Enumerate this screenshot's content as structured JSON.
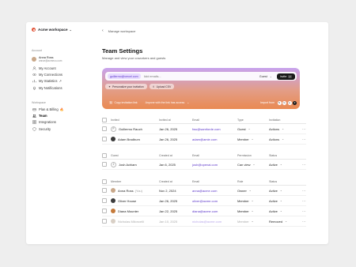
{
  "workspace": {
    "name": "Acme workspace"
  },
  "sidebar": {
    "account_label": "Account",
    "user": {
      "name": "Anna Ross",
      "email": "annar@acmeco.com"
    },
    "account_items": [
      {
        "label": "My Account",
        "icon": "user-icon"
      },
      {
        "label": "My Connections",
        "icon": "link-icon"
      },
      {
        "label": "My Statistics",
        "icon": "chart-icon",
        "suffix": "↗"
      },
      {
        "label": "My Notifications",
        "icon": "bell-icon"
      }
    ],
    "workspace_label": "Workspace",
    "workspace_items": [
      {
        "label": "Plan & Billing",
        "icon": "card-icon",
        "badge": "🔥"
      },
      {
        "label": "Team",
        "icon": "team-icon",
        "active": true
      },
      {
        "label": "Integrations",
        "icon": "grid-icon"
      },
      {
        "label": "Security",
        "icon": "shield-icon"
      }
    ]
  },
  "breadcrumb": {
    "label": "Manage workspace"
  },
  "page": {
    "title": "Team Settings",
    "subtitle": "Manage and view your coworkers and guests"
  },
  "invite": {
    "email_chip": "guillermo@vercel.com",
    "placeholder": "Add emails...",
    "role": "Guest",
    "button_label": "Invite",
    "button_kbd": "↵",
    "pills": [
      {
        "icon": "sparkle-icon",
        "label": "Personalize your invitation"
      },
      {
        "icon": "upload-icon",
        "label": "Upload CSV"
      }
    ],
    "copy_link_label": "Copy invitation link",
    "link_access_label": "Anyone with the link has access",
    "import_label": "Import from"
  },
  "invited_table": {
    "headers": [
      "Invited",
      "Invited at",
      "Email",
      "Type",
      "Invitation"
    ],
    "rows": [
      {
        "name": "Guillermo Rauch",
        "date": "Jan 26, 2025",
        "email": "fwu@samforde.com",
        "role": "Guest",
        "status": "Actions",
        "avatar_letter": "F",
        "avatar_color": "#ffffff"
      },
      {
        "name": "Adam Bradburn",
        "date": "Jan 26, 2025",
        "email": "adam@amie.com",
        "role": "Member",
        "status": "Actions",
        "avatar_letter": "",
        "avatar_color": "#3a3a3a"
      }
    ]
  },
  "guest_table": {
    "headers": [
      "Guest",
      "Created at",
      "Email",
      "Permission",
      "Status"
    ],
    "rows": [
      {
        "name": "Josh Achiam",
        "date": "Jan 6, 2025",
        "email": "josh@openai.com",
        "role": "Can view",
        "status": "Active",
        "avatar_letter": "J",
        "avatar_color": "#ffffff"
      }
    ]
  },
  "member_table": {
    "headers": [
      "Member",
      "Created at",
      "Email",
      "Role",
      "Status"
    ],
    "rows": [
      {
        "name": "Anna Ross",
        "you": "(You)",
        "date": "Nov 2, 2024",
        "email": "anna@acme.com",
        "role": "Owner",
        "status": "Active",
        "avatar_color": "#c9a88a"
      },
      {
        "name": "Oliver House",
        "date": "Jan 26, 2025",
        "email": "oliver@acme.com",
        "role": "Member",
        "status": "Active",
        "avatar_color": "#3c3c3c"
      },
      {
        "name": "Diana Mounter",
        "date": "Jan 22, 2025",
        "email": "diana@acme.com",
        "role": "Member",
        "status": "Active",
        "avatar_color": "#c57a3a"
      },
      {
        "name": "Nicholas Miloncelli",
        "date": "Jan 10, 2025",
        "email": "nicholas@acme.com",
        "role": "Member",
        "status": "Removed",
        "avatar_color": "#d9d0c6",
        "faded": true
      }
    ]
  }
}
